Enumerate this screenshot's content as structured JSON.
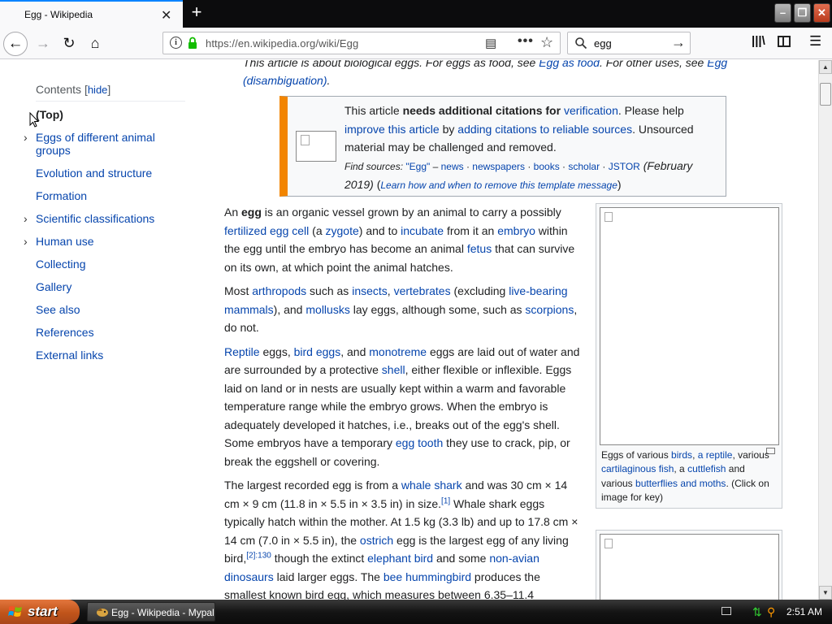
{
  "tab": {
    "title": "Egg - Wikipedia",
    "close": "✕"
  },
  "window": {
    "new_tab": "+",
    "minimize": "–",
    "maximize": "❐",
    "close": "✕"
  },
  "nav": {
    "back": "←",
    "forward": "→",
    "reload": "↻",
    "home": "⌂",
    "url": "https://en.wikipedia.org/wiki/Egg",
    "reader": "▤",
    "page_actions": "•••",
    "bookmark": "☆",
    "search_value": "egg",
    "search_go": "→",
    "library": "|||\\",
    "menu": "☰"
  },
  "toc": {
    "title": "Contents",
    "hide_prefix": "[",
    "hide": "hide",
    "hide_suffix": "]",
    "items": [
      {
        "label": "(Top)"
      },
      {
        "label": "Eggs of different animal groups",
        "chevron": "›"
      },
      {
        "label": "Evolution and structure"
      },
      {
        "label": "Formation"
      },
      {
        "label": "Scientific classifications",
        "chevron": "›"
      },
      {
        "label": "Human use",
        "chevron": "›"
      },
      {
        "label": "Collecting"
      },
      {
        "label": "Gallery"
      },
      {
        "label": "See also"
      },
      {
        "label": "References"
      },
      {
        "label": "External links"
      }
    ]
  },
  "hatnote": {
    "t1": "This article is about biological eggs. For eggs as food, see ",
    "l1": "Egg as food",
    "t2": ". For other uses, see ",
    "l2": "Egg (disambiguation)",
    "t3": "."
  },
  "ambox": {
    "t1": "This article ",
    "b1": "needs additional citations for ",
    "l1": "verification",
    "t2": ". Please help ",
    "l2": "improve this article",
    "t3": " by ",
    "l3": "adding citations to reliable sources",
    "t4": ". Unsourced material may be challenged and removed.",
    "find_label": "Find sources: ",
    "find_query": "\"Egg\"",
    "find_dash": " – ",
    "sources": [
      "news",
      "newspapers",
      "books",
      "scholar",
      "JSTOR"
    ],
    "sep": " · ",
    "date": " (February 2019)",
    "learn_open": " (",
    "learn": "Learn how and when to remove this template message",
    "learn_close": ")"
  },
  "para1": {
    "t1": "An ",
    "b1": "egg",
    "t2": " is an organic vessel grown by an animal to carry a possibly ",
    "l1": "fertilized egg cell",
    "t3": " (a ",
    "l2": "zygote",
    "t4": ") and to ",
    "l3": "incubate",
    "t5": " from it an ",
    "l4": "embryo",
    "t6": " within the egg until the embryo has become an animal ",
    "l5": "fetus",
    "t7": " that can survive on its own, at which point the animal hatches."
  },
  "para2": {
    "t1": "Most ",
    "l1": "arthropods",
    "t2": " such as ",
    "l2": "insects",
    "t3": ", ",
    "l3": "vertebrates",
    "t4": " (excluding ",
    "l4": "live-bearing mammals",
    "t5": "), and ",
    "l5": "mollusks",
    "t6": " lay eggs, although some, such as ",
    "l6": "scorpions",
    "t7": ", do not."
  },
  "para3": {
    "l1": "Reptile",
    "t1": " eggs, ",
    "l2": "bird eggs",
    "t2": ", and ",
    "l3": "monotreme",
    "t3": " eggs are laid out of water and are surrounded by a protective ",
    "l4": "shell",
    "t4": ", either flexible or inflexible. Eggs laid on land or in nests are usually kept within a warm and favorable temperature range while the embryo grows. When the embryo is adequately developed it hatches, i.e., breaks out of the egg's shell. Some embryos have a temporary ",
    "l5": "egg tooth",
    "t5": " they use to crack, pip, or break the eggshell or covering."
  },
  "para4": {
    "t1": "The largest recorded egg is from a ",
    "l1": "whale shark",
    "t2": " and was 30 cm × 14 cm × 9 cm (11.8 in × 5.5 in × 3.5 in) in size.",
    "s1": "[1]",
    "t3": " Whale shark eggs typically hatch within the mother. At 1.5 kg (3.3 lb) and up to 17.8 cm × 14 cm (7.0 in × 5.5 in), the ",
    "l2": "ostrich",
    "t4": " egg is the largest egg of any living bird,",
    "s2": "[2]:130",
    "t5": " though the extinct ",
    "l3": "elephant bird",
    "t6": " and some ",
    "l4": "non-avian dinosaurs",
    "t7": " laid larger eggs. The ",
    "l5": "bee hummingbird",
    "t8": " produces the smallest known bird egg, which measures between 6.35–11.4"
  },
  "infobox": {
    "t1": "Eggs of various ",
    "l1": "birds",
    "t2": ", ",
    "l2": "a reptile",
    "t3": ", various ",
    "l3": "cartilaginous fish",
    "t4": ", a ",
    "l4": "cuttlefish",
    "t5": " and various ",
    "l5": "butterflies and moths",
    "t6": ". (Click on image for key)"
  },
  "scroll": {
    "up": "▲",
    "down": "▼"
  },
  "taskbar": {
    "start": "start",
    "task": "Egg - Wikipedia - Mypal",
    "clock": "2:51 AM",
    "net": "⇅",
    "search": "⚲"
  },
  "colors": {
    "link": "#0645ad",
    "ambox_accent": "#f28500",
    "tab_accent": "#0a84ff",
    "start": "#c0541a"
  }
}
